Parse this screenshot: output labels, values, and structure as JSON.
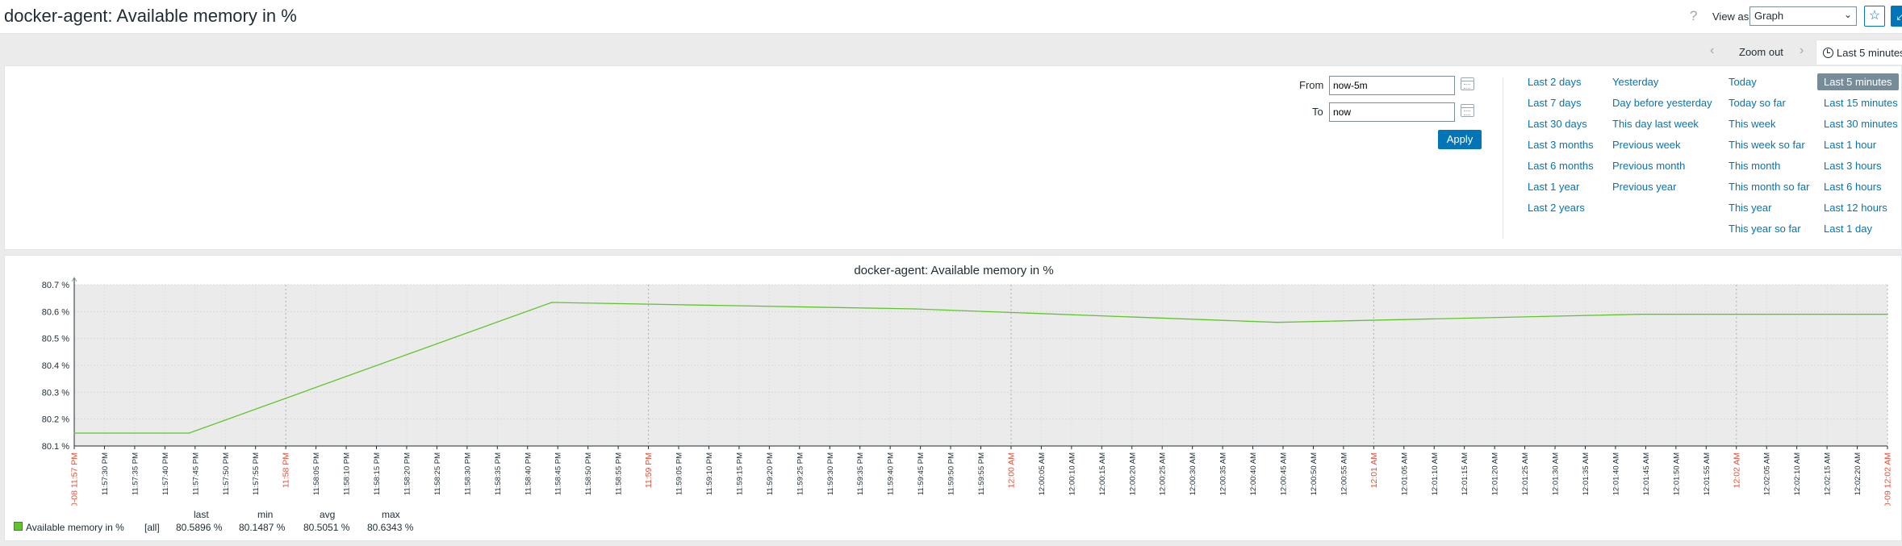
{
  "header": {
    "title": "docker-agent: Available memory in %",
    "help": "?",
    "view_as_label": "View as",
    "view_as_value": "Graph"
  },
  "timenav": {
    "zoom_out": "Zoom out",
    "active_tab": "Last 5 minutes"
  },
  "filter": {
    "from_label": "From",
    "from_value": "now-5m",
    "to_label": "To",
    "to_value": "now",
    "apply": "Apply",
    "quick_ranges": [
      [
        "Last 2 days",
        "Last 7 days",
        "Last 30 days",
        "Last 3 months",
        "Last 6 months",
        "Last 1 year",
        "Last 2 years"
      ],
      [
        "Yesterday",
        "Day before yesterday",
        "This day last week",
        "Previous week",
        "Previous month",
        "Previous year"
      ],
      [
        "Today",
        "Today so far",
        "This week",
        "This week so far",
        "This month",
        "This month so far",
        "This year",
        "This year so far"
      ],
      [
        "Last 5 minutes",
        "Last 15 minutes",
        "Last 30 minutes",
        "Last 1 hour",
        "Last 3 hours",
        "Last 6 hours",
        "Last 12 hours",
        "Last 1 day"
      ]
    ],
    "selected_range": "Last 5 minutes"
  },
  "graph": {
    "title": "docker-agent: Available memory in %",
    "legend": {
      "series_name": "Available memory in %",
      "all": "[all]",
      "last_label": "last",
      "min_label": "min",
      "avg_label": "avg",
      "max_label": "max",
      "last": "80.5896 %",
      "min": "80.1487 %",
      "avg": "80.5051 %",
      "max": "80.6343 %"
    }
  },
  "chart_data": {
    "type": "line",
    "title": "docker-agent: Available memory in %",
    "xlabel": "",
    "ylabel": "",
    "ylim": [
      80.1,
      80.7
    ],
    "y_ticks": [
      "80.7 %",
      "80.6 %",
      "80.5 %",
      "80.4 %",
      "80.3 %",
      "80.2 %",
      "80.1 %"
    ],
    "x_ticks": [
      "10-08 11:57 PM",
      "11:57:30 PM",
      "11:57:35 PM",
      "11:57:40 PM",
      "11:57:45 PM",
      "11:57:50 PM",
      "11:57:55 PM",
      "11:58 PM",
      "11:58:05 PM",
      "11:58:10 PM",
      "11:58:15 PM",
      "11:58:20 PM",
      "11:58:25 PM",
      "11:58:30 PM",
      "11:58:35 PM",
      "11:58:40 PM",
      "11:58:45 PM",
      "11:58:50 PM",
      "11:58:55 PM",
      "11:59 PM",
      "11:59:05 PM",
      "11:59:10 PM",
      "11:59:15 PM",
      "11:59:20 PM",
      "11:59:25 PM",
      "11:59:30 PM",
      "11:59:35 PM",
      "11:59:40 PM",
      "11:59:45 PM",
      "11:59:50 PM",
      "11:59:55 PM",
      "12:00 AM",
      "12:00:05 AM",
      "12:00:10 AM",
      "12:00:15 AM",
      "12:00:20 AM",
      "12:00:25 AM",
      "12:00:30 AM",
      "12:00:35 AM",
      "12:00:40 AM",
      "12:00:45 AM",
      "12:00:50 AM",
      "12:00:55 AM",
      "12:01 AM",
      "12:01:05 AM",
      "12:01:10 AM",
      "12:01:15 AM",
      "12:01:20 AM",
      "12:01:25 AM",
      "12:01:30 AM",
      "12:01:35 AM",
      "12:01:40 AM",
      "12:01:45 AM",
      "12:01:50 AM",
      "12:01:55 AM",
      "12:02 AM",
      "12:02:05 AM",
      "12:02:10 AM",
      "12:02:15 AM",
      "12:02:20 AM",
      "10-09 12:02 AM"
    ],
    "x_tick_highlight": [
      0,
      7,
      19,
      31,
      43,
      55,
      60
    ],
    "x_range_seconds": [
      0,
      300
    ],
    "grid": true,
    "series": [
      {
        "name": "Available memory in %",
        "color": "#5ec62c",
        "points": [
          {
            "t": 0,
            "v": 80.148
          },
          {
            "t": 19,
            "v": 80.148
          },
          {
            "t": 79,
            "v": 80.634
          },
          {
            "t": 139,
            "v": 80.61
          },
          {
            "t": 199,
            "v": 80.56
          },
          {
            "t": 259,
            "v": 80.59
          },
          {
            "t": 300,
            "v": 80.59
          }
        ]
      }
    ],
    "highlight_color": "#e0533b"
  }
}
